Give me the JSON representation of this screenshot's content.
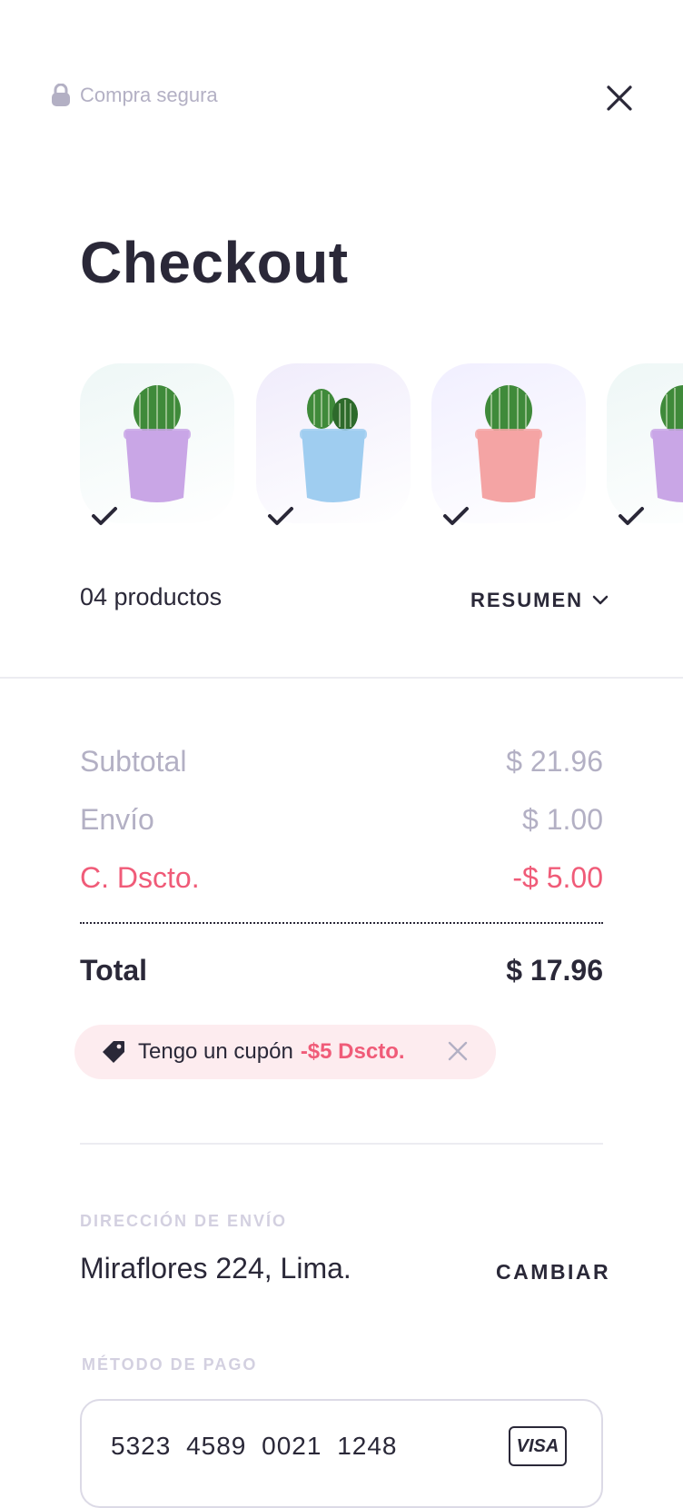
{
  "header": {
    "secure_label": "Compra segura"
  },
  "page_title": "Checkout",
  "products": [
    {
      "pot_color": "#c9a6e6",
      "bg_color": "#eef7f6",
      "cactus": "round"
    },
    {
      "pot_color": "#9fcdf0",
      "bg_color": "#f0ecfb",
      "cactus": "twin"
    },
    {
      "pot_color": "#f4a4a4",
      "bg_color": "#f1efff",
      "cactus": "round"
    },
    {
      "pot_color": "#c9a6e6",
      "bg_color": "#eef7f6",
      "cactus": "round"
    }
  ],
  "product_count": "04 productos",
  "summary_toggle": "RESUMEN",
  "totals": {
    "subtotal_label": "Subtotal",
    "subtotal_value": "$ 21.96",
    "shipping_label": "Envío",
    "shipping_value": "$ 1.00",
    "discount_label": "C. Dscto.",
    "discount_value": "-$ 5.00",
    "total_label": "Total",
    "total_value": "$ 17.96"
  },
  "coupon": {
    "text": "Tengo un cupón",
    "discount": "-$5 Dscto."
  },
  "shipping": {
    "section_label": "DIRECCIÓN DE ENVÍO",
    "address": "Miraflores 224, Lima.",
    "change_label": "CAMBIAR"
  },
  "payment": {
    "section_label": "MÉTODO DE PAGO",
    "card_number": "5323 4589 0021 1248",
    "card_brand": "VISA"
  },
  "colors": {
    "text": "#2a2838",
    "muted": "#b3b0c4",
    "accent": "#f05b78",
    "coupon_bg": "#fdecef"
  }
}
